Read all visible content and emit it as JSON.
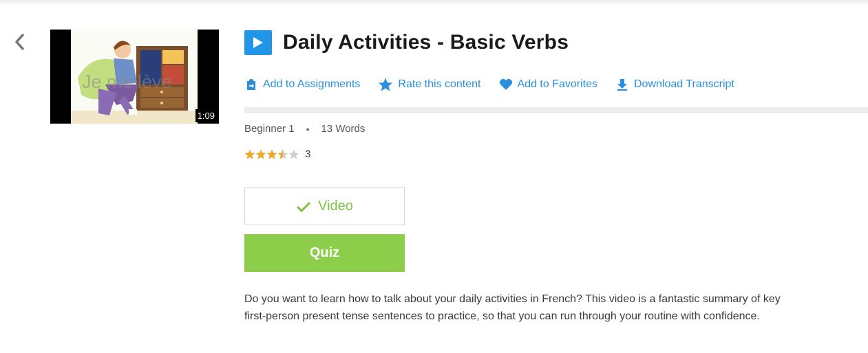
{
  "header": {
    "title": "Daily Activities - Basic Verbs"
  },
  "thumbnail": {
    "duration": "1:09",
    "watermark": "Je me lève"
  },
  "actions": [
    {
      "label": "Add to Assignments",
      "icon": "assignment-icon"
    },
    {
      "label": "Rate this content",
      "icon": "star-icon"
    },
    {
      "label": "Add to Favorites",
      "icon": "heart-icon"
    },
    {
      "label": "Download Transcript",
      "icon": "download-icon"
    }
  ],
  "meta": {
    "level": "Beginner 1",
    "words": "13 Words"
  },
  "rating": {
    "value": 3.5,
    "max": 5,
    "count": "3"
  },
  "buttons": {
    "video_label": "Video",
    "quiz_label": "Quiz"
  },
  "description": "Do you want to learn how to talk about your daily activities in French? This video is a fantastic summary of key first-person present tense sentences to practice, so that you can run through your routine with confidence.",
  "colors": {
    "accent_blue": "#2a8fdc",
    "play_badge": "#2196e6",
    "green": "#8cce4a",
    "check_green": "#7cc142",
    "star_gold": "#f5a623"
  }
}
